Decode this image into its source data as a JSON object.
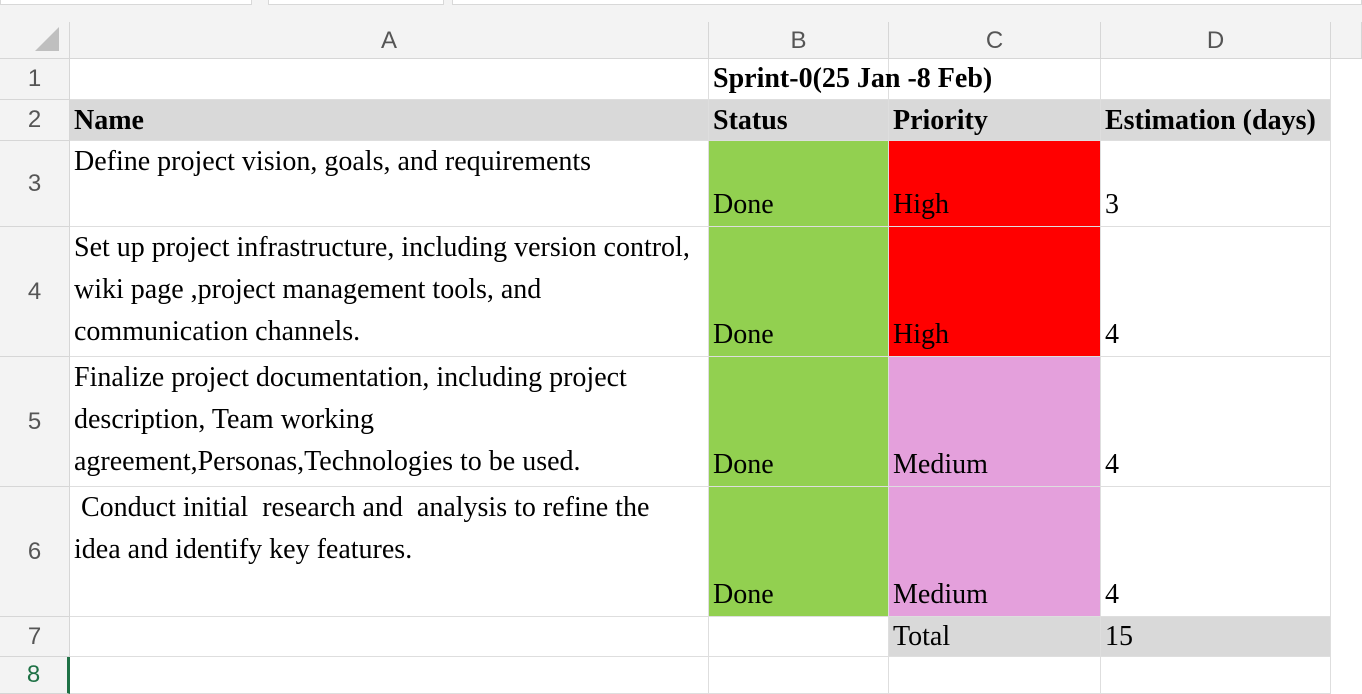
{
  "columns": [
    "A",
    "B",
    "C",
    "D"
  ],
  "rows": [
    "1",
    "2",
    "3",
    "4",
    "5",
    "6",
    "7",
    "8"
  ],
  "title": "Sprint-0(25 Jan -8 Feb)",
  "headers": {
    "name": "Name",
    "status": "Status",
    "priority": "Priority",
    "estimation": "Estimation (days)"
  },
  "tasks": [
    {
      "name": "Define project vision, goals, and requirements",
      "status": "Done",
      "priority": "High",
      "estimate": "3"
    },
    {
      "name": "Set up project infrastructure, including version control, wiki page ,project management tools, and communication channels.",
      "status": "Done",
      "priority": "High",
      "estimate": "4"
    },
    {
      "name": "Finalize project documentation, including project description, Team working agreement,Personas,Technologies to be used.",
      "status": "Done",
      "priority": "Medium",
      "estimate": "4"
    },
    {
      "name": " Conduct initial  research and  analysis to refine the  idea and identify key features.",
      "status": "Done",
      "priority": "Medium",
      "estimate": "4"
    }
  ],
  "total": {
    "label": "Total",
    "value": "15"
  },
  "colors": {
    "header_fill": "#d9d9d9",
    "status_done": "#92d050",
    "priority_high": "#ff0000",
    "priority_medium": "#e4a0dc",
    "active_row": "#1e7145"
  }
}
